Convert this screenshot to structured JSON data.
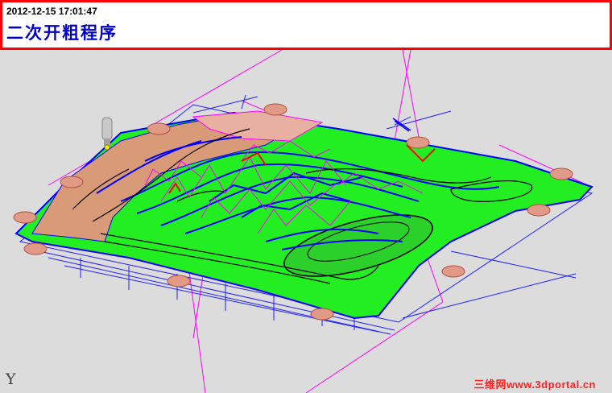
{
  "header": {
    "timestamp": "2012-12-15 17:01:47",
    "title": "二次开粗程序"
  },
  "viewport": {
    "axis_label": "Y",
    "colors": {
      "background": "#dcdcdc",
      "die_face": "#22ee22",
      "part_surface": "#d99a78",
      "toolpath": "#0000ff",
      "rapid_moves": "#ff00ff",
      "clamp_pads": "#e09a86",
      "tool": "#c0c0c0"
    }
  },
  "watermark": "三维网www.3dportal.cn"
}
